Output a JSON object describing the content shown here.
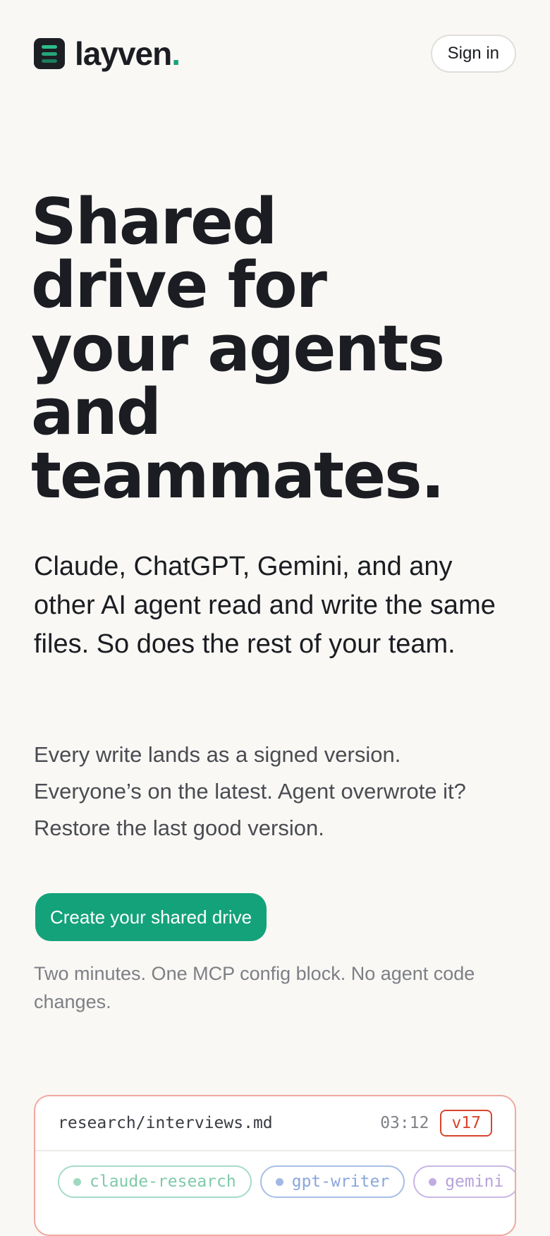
{
  "brand": {
    "name": "layven",
    "dot": ".",
    "colors": {
      "accent": "#14a27a",
      "dark": "#1c1f24"
    },
    "logo_icon": "stacked-bars-logo-icon"
  },
  "header": {
    "signin_label": "Sign in"
  },
  "hero": {
    "title_lines": [
      "Shared",
      "drive for",
      "your agents",
      "and",
      "teammates."
    ],
    "lead": "Claude, ChatGPT, Gemini, and any other AI agent read and write the same files. So does the rest of your team.",
    "sub_lines": [
      "Every write lands as a signed version.",
      "Everyone’s on the latest. Agent overwrote it?",
      "Restore the last good version."
    ],
    "cta_label": "Create your shared drive",
    "cta_note": "Two minutes. One MCP config block. No agent code changes."
  },
  "file_card": {
    "path": "research/interviews.md",
    "time": "03:12",
    "version": "v17",
    "agents": [
      {
        "name": "claude-research",
        "color": "#7fcaa9"
      },
      {
        "name": "gpt-writer",
        "color": "#8aa6dc"
      },
      {
        "name": "gemini",
        "color": "#b6a2dc"
      }
    ]
  }
}
